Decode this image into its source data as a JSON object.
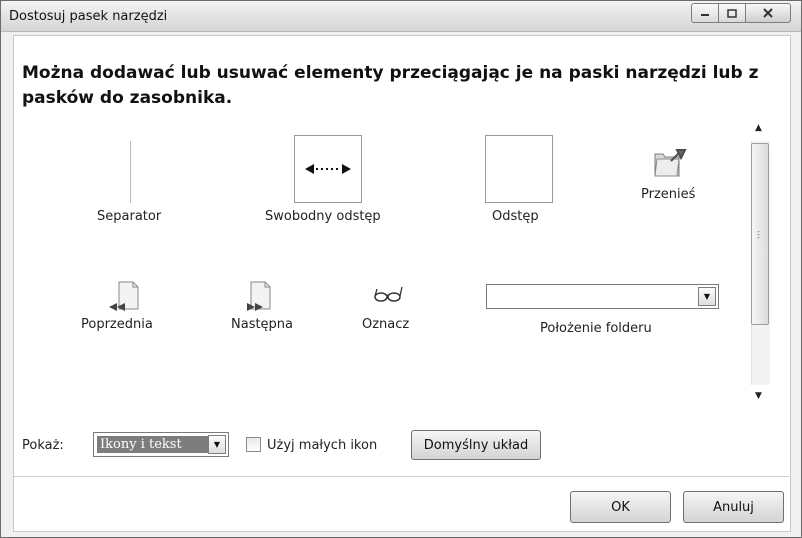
{
  "window": {
    "title": "Dostosuj pasek narzędzi"
  },
  "heading": "Można dodawać lub usuwać elementy przeciągając je na paski narzędzi lub z pasków do zasobnika.",
  "items": {
    "separator": "Separator",
    "free_space": "Swobodny odstęp",
    "space": "Odstęp",
    "move": "Przenieś",
    "previous": "Poprzednia",
    "next": "Następna",
    "mark": "Oznacz",
    "folder_location": "Położenie folderu"
  },
  "bottom": {
    "show_label": "Pokaż:",
    "show_value": "Ikony i tekst",
    "small_icons_label": "Użyj małych ikon",
    "small_icons_checked": false,
    "default_layout": "Domyślny układ"
  },
  "footer": {
    "ok": "OK",
    "cancel": "Anuluj"
  }
}
